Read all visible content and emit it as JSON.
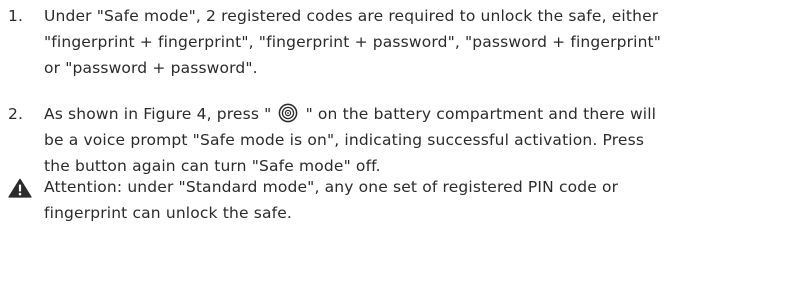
{
  "instructions": {
    "item1": {
      "number": "1.",
      "lines": [
        "Under \"Safe mode\", 2 registered codes are required to unlock the safe, either",
        "\"fingerprint + fingerprint\", \"fingerprint + password\", \"password + fingerprint\"",
        "or \"password + password\"."
      ]
    },
    "item2": {
      "number": "2.",
      "line1_before_icon": "As shown in Figure 4, press \"",
      "line1_after_icon": "\" on the battery compartment and there will",
      "line2": "be a voice prompt \"Safe mode is on\", indicating successful activation. Press",
      "line3": "the button again can turn \"Safe mode\" off.",
      "icon": "safe-mode-button-icon"
    },
    "attention": {
      "icon": "warning-triangle-icon",
      "line1": "Attention: under \"Standard mode\", any one set of registered PIN code or",
      "line2": "fingerprint can unlock the safe."
    }
  }
}
